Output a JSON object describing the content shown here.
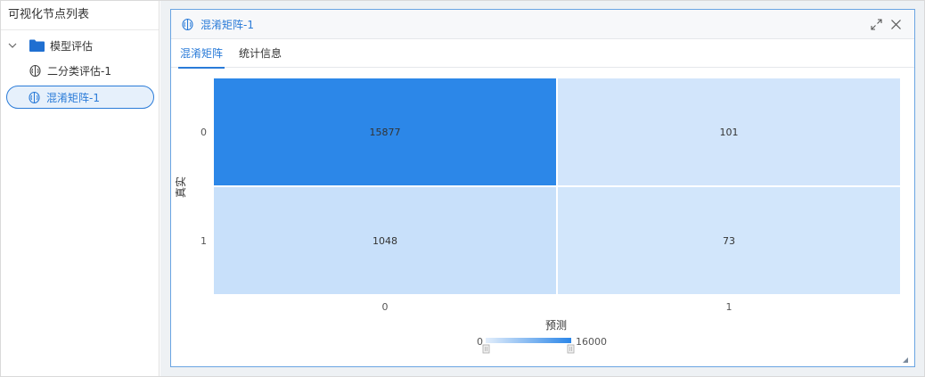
{
  "sidebar": {
    "title": "可视化节点列表",
    "folder_label": "模型评估",
    "items": [
      {
        "label": "二分类评估-1"
      },
      {
        "label": "混淆矩阵-1"
      }
    ]
  },
  "panel": {
    "title": "混淆矩阵-1",
    "tabs": [
      {
        "label": "混淆矩阵",
        "active": true
      },
      {
        "label": "统计信息",
        "active": false
      }
    ]
  },
  "colors": {
    "accent": "#2a7bd8",
    "cell_high": "#2b86e8",
    "cell_low": "#d3e6fb"
  },
  "chart_data": {
    "type": "heatmap",
    "x_categories": [
      "0",
      "1"
    ],
    "y_categories": [
      "0",
      "1"
    ],
    "values": [
      [
        15877,
        101
      ],
      [
        1048,
        73
      ]
    ],
    "xlabel": "预测",
    "ylabel": "真实",
    "colorbar": {
      "min": 0,
      "max": 16000,
      "min_label": "0",
      "max_label": "16000"
    }
  }
}
